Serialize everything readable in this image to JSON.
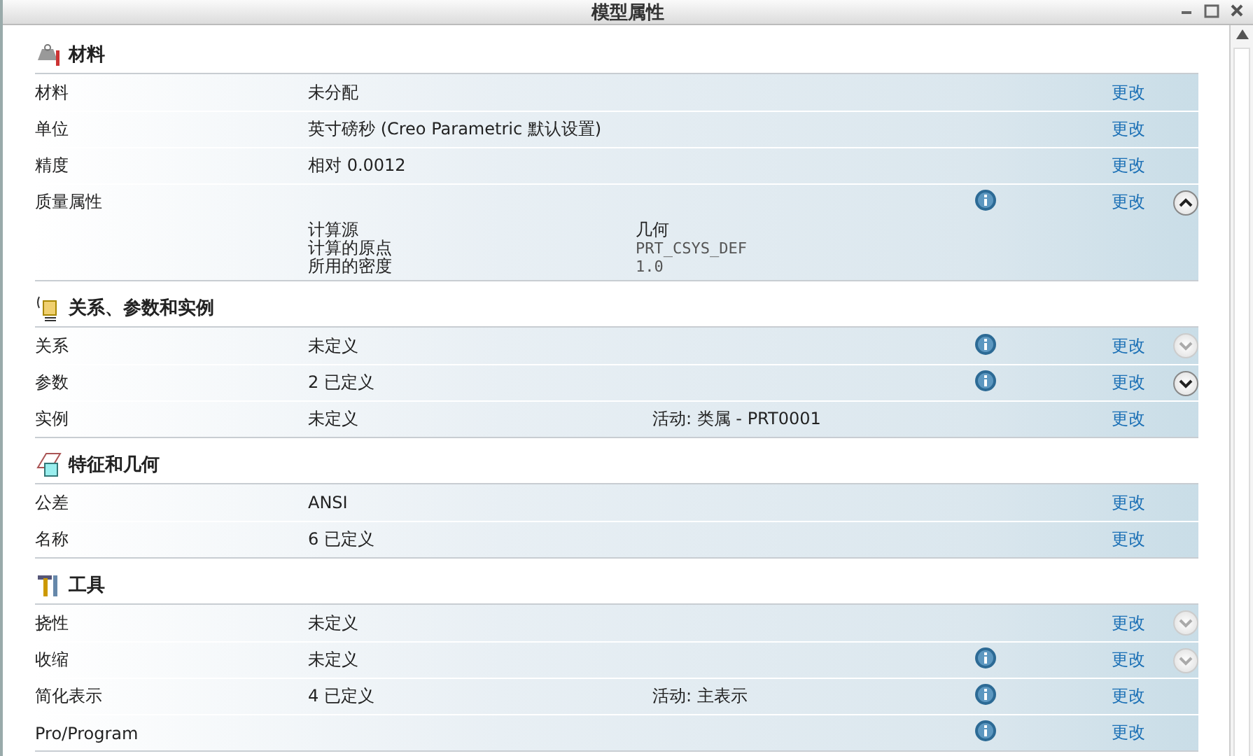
{
  "window": {
    "title": "模型属性"
  },
  "sections": [
    {
      "title": "材料",
      "rows": [
        {
          "label": "材料",
          "value": "未分配",
          "action": "更改"
        },
        {
          "label": "单位",
          "value": "英寸磅秒 (Creo Parametric 默认设置)",
          "action": "更改"
        },
        {
          "label": "精度",
          "value": "相对 0.0012",
          "action": "更改"
        },
        {
          "label": "质量属性",
          "info": true,
          "action": "更改",
          "toggle": {
            "expanded": true,
            "disabled": false
          },
          "details": [
            {
              "name": "计算源",
              "value": "几何"
            },
            {
              "name": "计算的原点",
              "value": "PRT_CSYS_DEF"
            },
            {
              "name": "所用的密度",
              "value": "1.0"
            }
          ]
        }
      ]
    },
    {
      "title": "关系、参数和实例",
      "rows": [
        {
          "label": "关系",
          "value": "未定义",
          "info": true,
          "action": "更改",
          "toggle": {
            "expanded": false,
            "disabled": true
          }
        },
        {
          "label": "参数",
          "value": "2 已定义",
          "info": true,
          "action": "更改",
          "toggle": {
            "expanded": false,
            "disabled": false
          }
        },
        {
          "label": "实例",
          "value": "未定义",
          "note": "活动: 类属 - PRT0001",
          "action": "更改"
        }
      ]
    },
    {
      "title": "特征和几何",
      "rows": [
        {
          "label": "公差",
          "value": "ANSI",
          "action": "更改"
        },
        {
          "label": "名称",
          "value": "6 已定义",
          "action": "更改"
        }
      ]
    },
    {
      "title": "工具",
      "rows": [
        {
          "label": "挠性",
          "value": "未定义",
          "action": "更改",
          "toggle": {
            "expanded": false,
            "disabled": true
          }
        },
        {
          "label": "收缩",
          "value": "未定义",
          "info": true,
          "action": "更改",
          "toggle": {
            "expanded": false,
            "disabled": true
          }
        },
        {
          "label": "简化表示",
          "value": "4 已定义",
          "note": "活动: 主表示",
          "info": true,
          "action": "更改"
        },
        {
          "label": "Pro/Program",
          "info": true,
          "action": "更改"
        }
      ]
    }
  ]
}
